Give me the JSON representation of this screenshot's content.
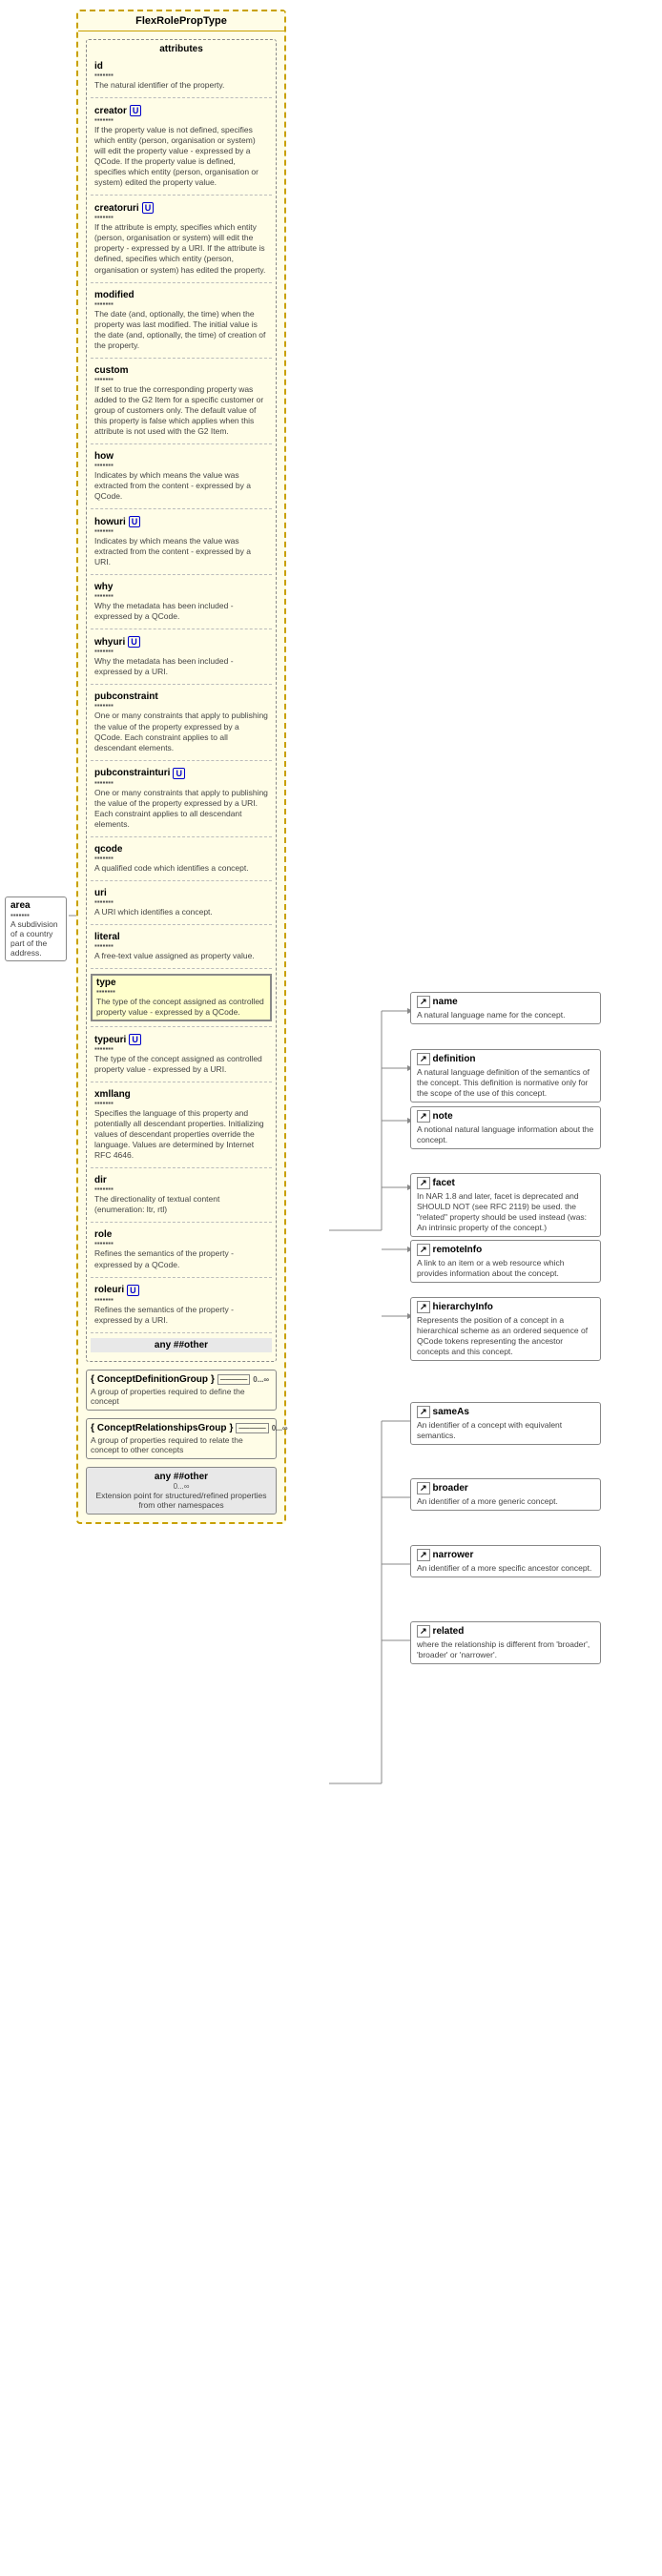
{
  "title": "FlexRolePropType",
  "attributes_label": "attributes",
  "properties": [
    {
      "name": "id",
      "dots": "▪▪▪▪▪▪▪",
      "desc": "The natural identifier of the property."
    },
    {
      "name": "creator",
      "uri": true,
      "dots": "▪▪▪▪▪▪▪",
      "desc": "If the property value is not defined, specifies which entity (person, organisation or system) will edit the property value - expressed by a QCode. If the property value is defined, specifies which entity (person, organisation or system) edited the property value."
    },
    {
      "name": "creatoruri",
      "uri": true,
      "dots": "▪▪▪▪▪▪▪",
      "desc": "If the attribute is empty, specifies which entity (person, organisation or system) will edit the property - expressed by a URI. If the attribute is defined, specifies which entity (person, organisation or system) has edited the property."
    },
    {
      "name": "modified",
      "dots": "▪▪▪▪▪▪▪",
      "desc": "The date (and, optionally, the time) when the property was last modified. The initial value is the date (and, optionally, the time) of creation of the property."
    },
    {
      "name": "custom",
      "dots": "▪▪▪▪▪▪▪",
      "desc": "If set to true the corresponding property was added to the G2 Item for a specific customer or group of customers only. The default value of this property is false which applies when this attribute is not used with the G2 Item."
    },
    {
      "name": "how",
      "uri": false,
      "dots": "▪▪▪▪▪▪▪",
      "desc": "Indicates by which means the value was extracted from the content - expressed by a QCode."
    },
    {
      "name": "howuri",
      "uri": true,
      "dots": "▪▪▪▪▪▪▪",
      "desc": "Indicates by which means the value was extracted from the content - expressed by a URI."
    },
    {
      "name": "why",
      "dots": "▪▪▪▪▪▪▪",
      "desc": "Why the metadata has been included - expressed by a QCode."
    },
    {
      "name": "whyuri",
      "uri": true,
      "dots": "▪▪▪▪▪▪▪",
      "desc": "Why the metadata has been included - expressed by a URI."
    },
    {
      "name": "pubconstraint",
      "dots": "▪▪▪▪▪▪▪",
      "desc": "One or many constraints that apply to publishing the value of the property expressed by a QCode. Each constraint applies to all descendant elements."
    },
    {
      "name": "pubconstrainturi",
      "uri": true,
      "dots": "▪▪▪▪▪▪▪",
      "desc": "One or many constraints that apply to publishing the value of the property expressed by a URI. Each constraint applies to all descendant elements."
    },
    {
      "name": "qcode",
      "dots": "▪▪▪▪▪▪▪",
      "desc": "A qualified code which identifies a concept."
    },
    {
      "name": "uri",
      "dots": "▪▪▪▪▪▪▪",
      "desc": "A URI which identifies a concept."
    },
    {
      "name": "literal",
      "dots": "▪▪▪▪▪▪▪",
      "desc": "A free-text value assigned as property value."
    },
    {
      "name": "type",
      "highlight": true,
      "dots": "▪▪▪▪▪▪▪",
      "desc": "The type of the concept assigned as controlled property value - expressed by a QCode."
    },
    {
      "name": "typeuri",
      "uri": true,
      "dots": "▪▪▪▪▪▪▪",
      "desc": "The type of the concept assigned as controlled property value - expressed by a URI."
    },
    {
      "name": "xmllang",
      "dots": "▪▪▪▪▪▪▪",
      "desc": "Specifies the language of this property and potentially all descendant properties. Initializing values of descendant properties override the language. Values are determined by Internet RFC 4646."
    },
    {
      "name": "dir",
      "dots": "▪▪▪▪▪▪▪",
      "desc": "The directionality of textual content (enumeration: ltr, rtl)"
    },
    {
      "name": "role",
      "dots": "▪▪▪▪▪▪▪",
      "desc": "Refines the semantics of the property - expressed by a QCode."
    },
    {
      "name": "roleuri",
      "uri": true,
      "dots": "▪▪▪▪▪▪▪",
      "desc": "Refines the semantics of the property - expressed by a URI."
    },
    {
      "name": "any ##other",
      "is_other": true,
      "dots": "▪▪▪▪▪▪▪",
      "desc": ""
    }
  ],
  "area_box": {
    "name": "area",
    "dots": "▪▪▪▪▪▪▪",
    "desc": "A subdivision of a country part of the address."
  },
  "concept_definition_group": {
    "name": "ConceptDefinitionGroup",
    "mult": "0...∞",
    "desc": "A group of properties required to define the concept"
  },
  "concept_relationships_group": {
    "name": "ConceptRelationshipsGroup",
    "mult": "0...∞",
    "desc": "A group of properties required to relate the concept to other concepts"
  },
  "right_boxes": [
    {
      "id": "name",
      "name": "name",
      "icon": true,
      "desc": "A natural language name for the concept."
    },
    {
      "id": "definition",
      "name": "definition",
      "icon": true,
      "desc": "A natural language definition of the semantics of the concept. This definition is normative only for the scope of the use of this concept."
    },
    {
      "id": "note",
      "name": "note",
      "icon": true,
      "desc": "A notional natural language information about the concept."
    },
    {
      "id": "facet",
      "name": "facet",
      "icon": true,
      "desc": "In NAR 1.8 and later, facet is deprecated and SHOULD NOT (see RFC 2119) be used. the \"related\" property should be used instead (was: An intrinsic property of the concept.)"
    },
    {
      "id": "remoteinfo",
      "name": "remoteInfo",
      "icon": true,
      "desc": "A link to an item or a web resource which provides information about the concept."
    },
    {
      "id": "hierarchyinfo",
      "name": "hierarchyInfo",
      "icon": true,
      "desc": "Represents the position of a concept in a hierarchical scheme as an ordered sequence of QCode tokens representing the ancestor concepts and this concept."
    },
    {
      "id": "sameas",
      "name": "sameAs",
      "icon": true,
      "desc": "An identifier of a concept with equivalent semantics."
    },
    {
      "id": "broader",
      "name": "broader",
      "icon": true,
      "desc": "An identifier of a more generic concept."
    },
    {
      "id": "narrower",
      "name": "narrower",
      "icon": true,
      "desc": "An identifier of a more specific ancestor concept."
    },
    {
      "id": "related",
      "name": "related",
      "icon": true,
      "desc": "where the relationship is different from 'broader', 'broader' or 'narrower'."
    }
  ],
  "any_other_bottom": {
    "label": "any ##other",
    "mult": "0...∞",
    "desc": "Extension point for structured/refined properties from other namespaces"
  }
}
